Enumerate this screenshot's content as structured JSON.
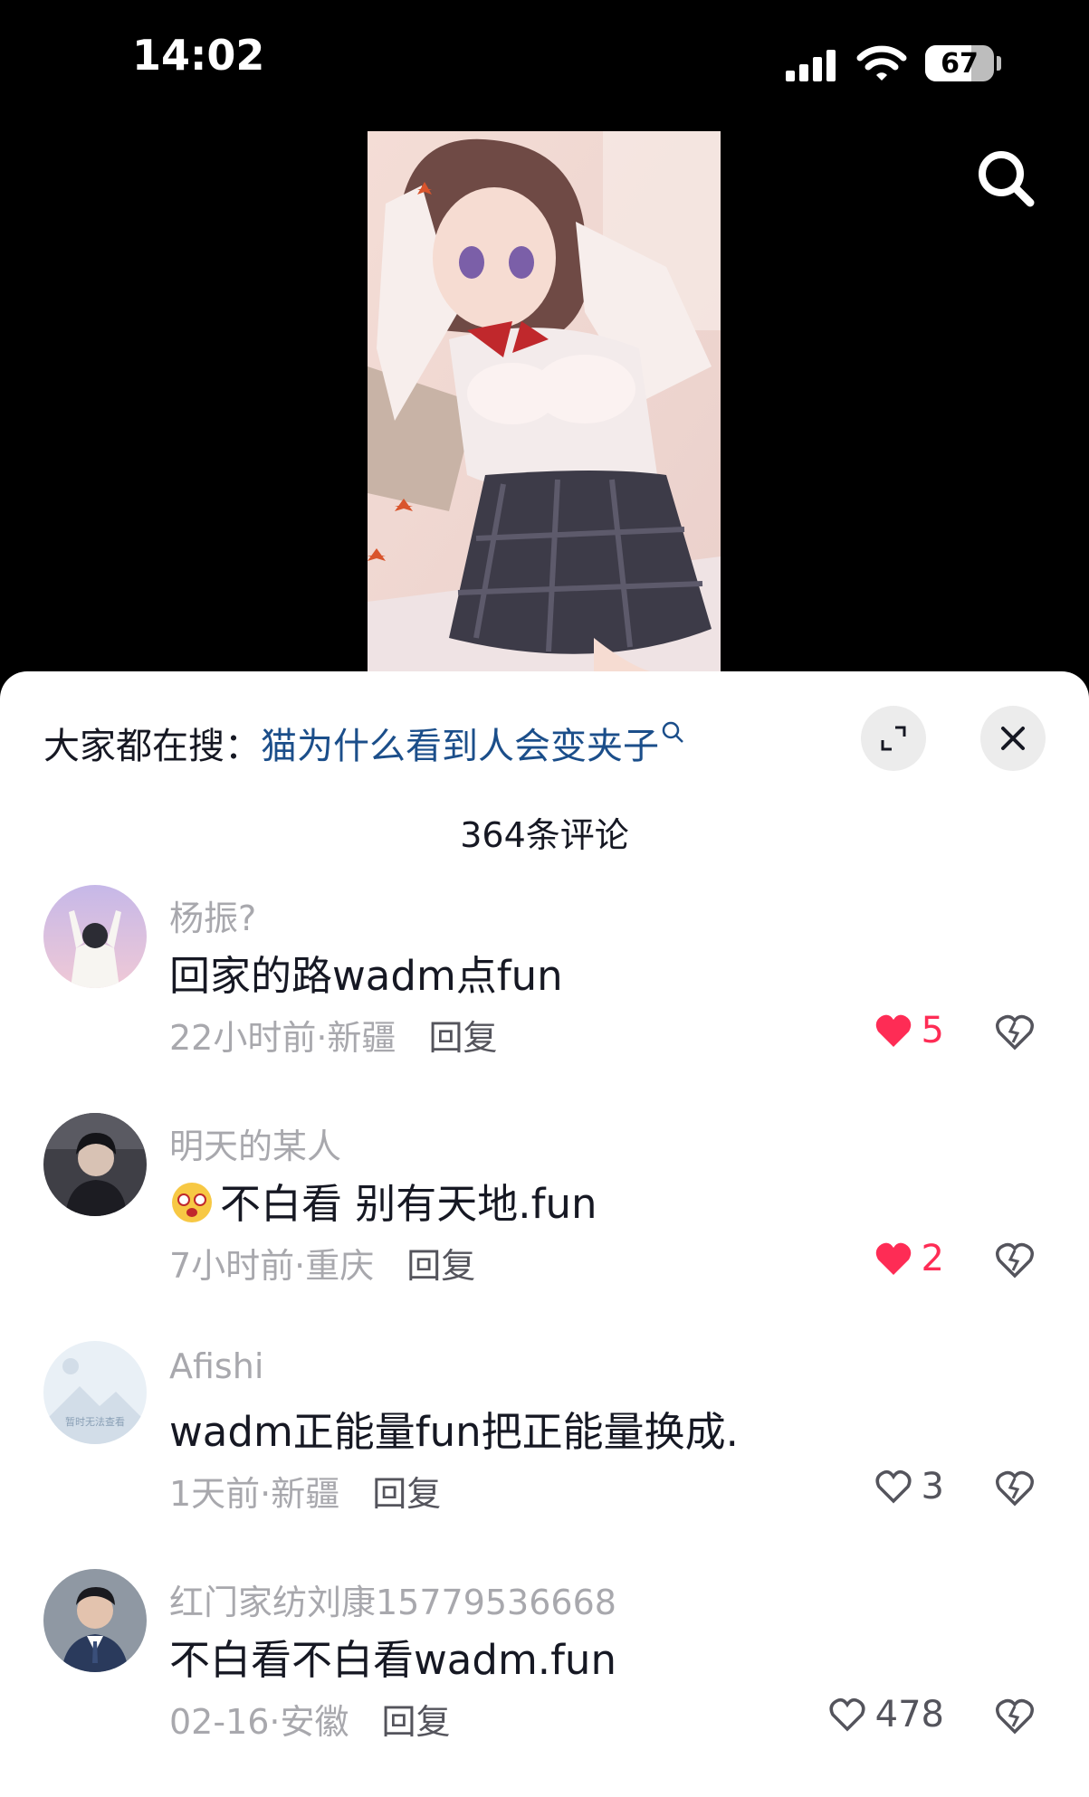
{
  "status_bar": {
    "time": "14:02",
    "battery": "67",
    "battery_level": 0.67
  },
  "header": {
    "search_icon": "search-icon"
  },
  "sheet": {
    "trending_label": "大家都在搜：",
    "trending_query": "猫为什么看到人会变夹子",
    "comment_count": "364条评论",
    "expand_icon": "expand-icon",
    "close_icon": "close-icon"
  },
  "comments": [
    {
      "username": "杨振?",
      "text": "回家的路wadm点fun",
      "time_location": "22小时前·新疆",
      "reply": "回复",
      "likes": "5",
      "liked": true
    },
    {
      "username": "明天的某人",
      "text": "不白看  别有天地.fun",
      "time_location": "7小时前·重庆",
      "reply": "回复",
      "likes": "2",
      "liked": true
    },
    {
      "username": "Afishi",
      "text": "wadm正能量fun把正能量换成.",
      "time_location": "1天前·新疆",
      "reply": "回复",
      "likes": "3",
      "liked": false,
      "avatar_placeholder": "暂时无法查看"
    },
    {
      "username": "红门家纺刘康15779536668",
      "text": "不白看不白看wadm.fun",
      "time_location": "02-16·安徽",
      "reply": "回复",
      "likes": "478",
      "liked": false
    }
  ],
  "colors": {
    "like_active": "#fe2c55",
    "link": "#1b4e8a",
    "muted": "#a8a8ad"
  }
}
